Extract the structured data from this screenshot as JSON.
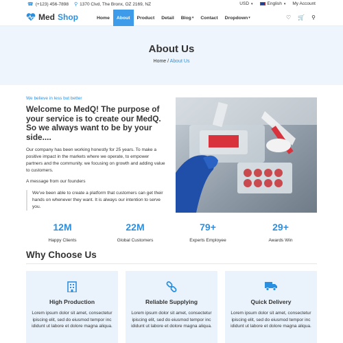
{
  "topbar": {
    "phone": "(+123) 456-7898",
    "address": "1370 Clvd, The Bronx, OZ 2169, NZ",
    "currency": "USD",
    "language": "English",
    "account": "My Account"
  },
  "nav": {
    "logo_part1": "Med",
    "logo_part2": "Shop",
    "items": [
      {
        "label": "Home"
      },
      {
        "label": "About"
      },
      {
        "label": "Product"
      },
      {
        "label": "Detail"
      },
      {
        "label": "Blog"
      },
      {
        "label": "Contact"
      },
      {
        "label": "Dropdown"
      }
    ]
  },
  "hero": {
    "title": "About Us",
    "crumb_home": "Home",
    "crumb_sep": "/",
    "crumb_current": "About Us"
  },
  "about": {
    "tagline": "We believe in less but better",
    "heading": "Welcome to MedQ! The purpose of your service is to create our MedQ. So we always want to be by your side....",
    "description": "Our company has been working honestly for 25 years. To make a positive impact in the markets where we operate, to empower partners and the community. we focusing on growth and adding value to customers.",
    "message_label": "A message from our founders",
    "quote": "We've been able to create a platform that customers can get their hands on whenever they want. It is always our intention to serve you."
  },
  "stats": [
    {
      "value": "12M",
      "label": "Happy Clients"
    },
    {
      "value": "22M",
      "label": "Global Customers"
    },
    {
      "value": "79+",
      "label": "Experts Employee"
    },
    {
      "value": "29+",
      "label": "Awards Win"
    }
  ],
  "why": {
    "title": "Why Choose Us",
    "cards": [
      {
        "title": "High Production",
        "icon": "building-icon",
        "text": "Lorem ipsum dolor sit amet, consectetur ipiscing elit, sed do eiusmod tempor inc ididunt ut labore et dolore magna aliqua."
      },
      {
        "title": "Reliable Supplying",
        "icon": "link-icon",
        "text": "Lorem ipsum dolor sit amet, consectetur ipiscing elit, sed do eiusmod tempor inc ididunt ut labore et dolore magna aliqua."
      },
      {
        "title": "Quick Delivery",
        "icon": "truck-icon",
        "text": "Lorem ipsum dolor sit amet, consectetur ipiscing elit, sed do eiusmod tempor inc ididunt ut labore et dolore magna aliqua."
      }
    ]
  },
  "colors": {
    "accent": "#2b8fe0",
    "hero_bg": "#eef5fc",
    "card_bg": "#eaf3fc"
  }
}
